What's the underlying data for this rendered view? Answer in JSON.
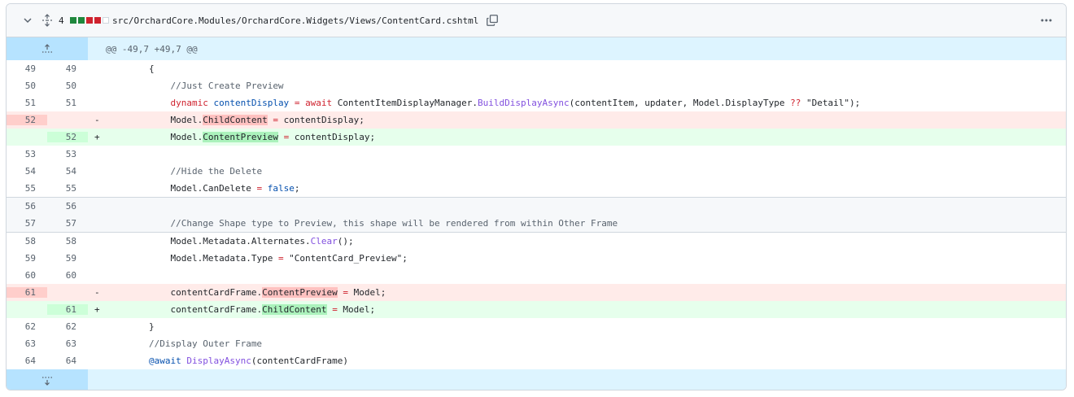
{
  "header": {
    "change_count": "4",
    "diffstat": [
      "add",
      "add",
      "del",
      "del",
      "neu"
    ],
    "file_path": "src/OrchardCore.Modules/OrchardCore.Widgets/Views/ContentCard.cshtml",
    "colors": {
      "add": "#1f883d",
      "del": "#cf222e"
    }
  },
  "hunk_header": "@@ -49,7 +49,7 @@",
  "lines": [
    {
      "type": "ctx",
      "a": "49",
      "b": "49",
      "indent": "        ",
      "tokens": [
        {
          "t": "{",
          "c": ""
        }
      ]
    },
    {
      "type": "ctx",
      "a": "50",
      "b": "50",
      "indent": "            ",
      "tokens": [
        {
          "t": "//Just Create Preview",
          "c": "cm"
        }
      ]
    },
    {
      "type": "ctx",
      "a": "51",
      "b": "51",
      "indent": "            ",
      "tokens": [
        {
          "t": "dynamic",
          "c": "kw"
        },
        {
          "t": " ",
          "c": ""
        },
        {
          "t": "contentDisplay",
          "c": "ty"
        },
        {
          "t": " ",
          "c": ""
        },
        {
          "t": "=",
          "c": "kw"
        },
        {
          "t": " ",
          "c": ""
        },
        {
          "t": "await",
          "c": "kw"
        },
        {
          "t": " ContentItemDisplayManager.",
          "c": ""
        },
        {
          "t": "BuildDisplayAsync",
          "c": "fn"
        },
        {
          "t": "(contentItem, updater, Model.DisplayType ",
          "c": ""
        },
        {
          "t": "??",
          "c": "kw"
        },
        {
          "t": " \"Detail\");",
          "c": ""
        }
      ]
    },
    {
      "type": "del",
      "a": "52",
      "b": "",
      "marker": "-",
      "indent": "            ",
      "tokens": [
        {
          "t": "Model.",
          "c": ""
        },
        {
          "t": "ChildContent",
          "c": "hl-del"
        },
        {
          "t": " ",
          "c": ""
        },
        {
          "t": "=",
          "c": "kw"
        },
        {
          "t": " contentDisplay;",
          "c": ""
        }
      ]
    },
    {
      "type": "add",
      "a": "",
      "b": "52",
      "marker": "+",
      "indent": "            ",
      "tokens": [
        {
          "t": "Model.",
          "c": ""
        },
        {
          "t": "ContentPreview",
          "c": "hl-add"
        },
        {
          "t": " ",
          "c": ""
        },
        {
          "t": "=",
          "c": "kw"
        },
        {
          "t": " contentDisplay;",
          "c": ""
        }
      ]
    },
    {
      "type": "ctx",
      "a": "53",
      "b": "53",
      "indent": "",
      "tokens": []
    },
    {
      "type": "ctx",
      "a": "54",
      "b": "54",
      "indent": "            ",
      "tokens": [
        {
          "t": "//Hide the Delete",
          "c": "cm"
        }
      ]
    },
    {
      "type": "ctx",
      "a": "55",
      "b": "55",
      "indent": "            ",
      "tokens": [
        {
          "t": "Model.CanDelete ",
          "c": ""
        },
        {
          "t": "=",
          "c": "kw"
        },
        {
          "t": " ",
          "c": ""
        },
        {
          "t": "false",
          "c": "ty"
        },
        {
          "t": ";",
          "c": ""
        }
      ]
    },
    {
      "type": "sep",
      "a": "56",
      "b": "56",
      "border": "top",
      "indent": "",
      "tokens": []
    },
    {
      "type": "sep",
      "a": "57",
      "b": "57",
      "border": "bottom",
      "indent": "            ",
      "tokens": [
        {
          "t": "//Change Shape type to Preview, this shape will be rendered from within Other Frame",
          "c": "cm"
        }
      ]
    },
    {
      "type": "ctx",
      "a": "58",
      "b": "58",
      "indent": "            ",
      "tokens": [
        {
          "t": "Model.Metadata.Alternates.",
          "c": ""
        },
        {
          "t": "Clear",
          "c": "fn"
        },
        {
          "t": "();",
          "c": ""
        }
      ]
    },
    {
      "type": "ctx",
      "a": "59",
      "b": "59",
      "indent": "            ",
      "tokens": [
        {
          "t": "Model.Metadata.Type ",
          "c": ""
        },
        {
          "t": "=",
          "c": "kw"
        },
        {
          "t": " \"ContentCard_Preview\";",
          "c": ""
        }
      ]
    },
    {
      "type": "ctx",
      "a": "60",
      "b": "60",
      "indent": "",
      "tokens": []
    },
    {
      "type": "del",
      "a": "61",
      "b": "",
      "marker": "-",
      "indent": "            ",
      "tokens": [
        {
          "t": "contentCardFrame.",
          "c": ""
        },
        {
          "t": "ContentPreview",
          "c": "hl-del"
        },
        {
          "t": " ",
          "c": ""
        },
        {
          "t": "=",
          "c": "kw"
        },
        {
          "t": " Model;",
          "c": ""
        }
      ]
    },
    {
      "type": "add",
      "a": "",
      "b": "61",
      "marker": "+",
      "indent": "            ",
      "tokens": [
        {
          "t": "contentCardFrame.",
          "c": ""
        },
        {
          "t": "ChildContent",
          "c": "hl-add"
        },
        {
          "t": " ",
          "c": ""
        },
        {
          "t": "=",
          "c": "kw"
        },
        {
          "t": " Model;",
          "c": ""
        }
      ]
    },
    {
      "type": "ctx",
      "a": "62",
      "b": "62",
      "indent": "        ",
      "tokens": [
        {
          "t": "}",
          "c": ""
        }
      ]
    },
    {
      "type": "ctx",
      "a": "63",
      "b": "63",
      "indent": "        ",
      "tokens": [
        {
          "t": "//Display Outer Frame",
          "c": "cm"
        }
      ]
    },
    {
      "type": "ctx",
      "a": "64",
      "b": "64",
      "indent": "        ",
      "tokens": [
        {
          "t": "@await",
          "c": "ty"
        },
        {
          "t": " ",
          "c": ""
        },
        {
          "t": "DisplayAsync",
          "c": "fn"
        },
        {
          "t": "(contentCardFrame)",
          "c": ""
        }
      ]
    }
  ]
}
